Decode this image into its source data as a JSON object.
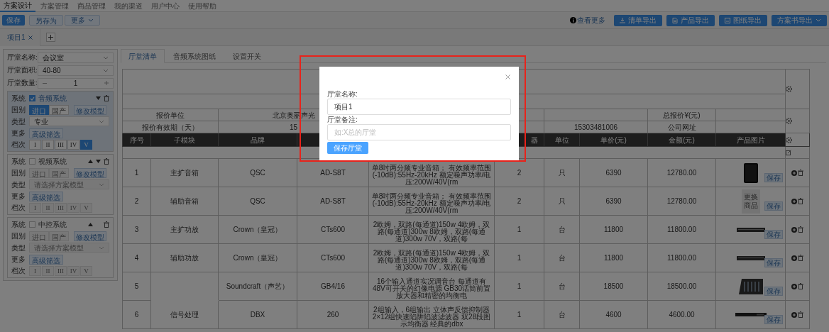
{
  "top_nav": [
    {
      "label": "方案设计",
      "selected": true
    },
    {
      "label": "方案管理",
      "selected": false
    },
    {
      "label": "商品管理",
      "selected": false
    },
    {
      "label": "我的渠道",
      "selected": false
    },
    {
      "label": "用户中心",
      "selected": false
    },
    {
      "label": "使用帮助",
      "selected": false
    }
  ],
  "toolbar": {
    "left_buttons": [
      {
        "label": "保存",
        "kind": "primary"
      },
      {
        "label": "另存为",
        "kind": "default"
      },
      {
        "label": "更多",
        "kind": "dropdown"
      }
    ],
    "help_link": "查看更多",
    "export_buttons": [
      {
        "label": "清单导出",
        "kind": "download"
      },
      {
        "label": "产品导出",
        "kind": "file"
      },
      {
        "label": "图纸导出",
        "kind": "image"
      },
      {
        "label": "方案书导出",
        "kind": "dropdown"
      }
    ]
  },
  "project_tabs": [
    {
      "label": "项目1",
      "selected": true
    }
  ],
  "left_panel": {
    "fields": [
      {
        "label": "厅堂名称:",
        "value": "会议室",
        "kind": "select"
      },
      {
        "label": "厅堂面积:",
        "value": "40-80",
        "kind": "select"
      },
      {
        "label": "厅堂数量:",
        "value": "1",
        "kind": "stepper"
      }
    ],
    "systems": [
      {
        "system_label": "系统",
        "name": "音频系统",
        "checked": true,
        "can_move_up": false,
        "can_move_down": true,
        "origin_label": "国别",
        "origins": [
          {
            "label": "进口",
            "selected": true
          },
          {
            "label": "国产",
            "selected": false
          }
        ],
        "modify_button": "修改模型",
        "type_label": "类型",
        "type_value": "专业",
        "more_label": "更多",
        "filter_button": "高级筛选",
        "grade_label": "档次",
        "grades": [
          {
            "label": "I",
            "selected": false
          },
          {
            "label": "II",
            "selected": false
          },
          {
            "label": "III",
            "selected": false
          },
          {
            "label": "IV",
            "selected": false
          },
          {
            "label": "V",
            "selected": true
          }
        ]
      },
      {
        "system_label": "系统",
        "name": "视频系统",
        "checked": false,
        "can_move_up": true,
        "can_move_down": true,
        "origin_label": "国别",
        "origins": [
          {
            "label": "进口",
            "selected": false
          },
          {
            "label": "国产",
            "selected": false
          }
        ],
        "modify_button": "修改模型",
        "type_label": "类型",
        "type_placeholder": "请选择方案模型",
        "more_label": "更多",
        "filter_button": "高级筛选",
        "grade_label": "档次",
        "grades": [
          {
            "label": "I",
            "selected": false
          },
          {
            "label": "II",
            "selected": false
          },
          {
            "label": "III",
            "selected": false
          },
          {
            "label": "IV",
            "selected": false
          },
          {
            "label": "V",
            "selected": false
          }
        ]
      },
      {
        "system_label": "系统",
        "name": "中控系统",
        "checked": false,
        "can_move_up": true,
        "can_move_down": false,
        "origin_label": "国别",
        "origins": [
          {
            "label": "进口",
            "selected": false
          },
          {
            "label": "国产",
            "selected": false
          }
        ],
        "modify_button": "修改模型",
        "type_label": "类型",
        "type_placeholder": "请选择方案模型",
        "more_label": "更多",
        "filter_button": "高级筛选",
        "grade_label": "档次",
        "grades": [
          {
            "label": "I",
            "selected": false
          },
          {
            "label": "II",
            "selected": false
          },
          {
            "label": "III",
            "selected": false
          },
          {
            "label": "IV",
            "selected": false
          },
          {
            "label": "V",
            "selected": false
          }
        ]
      }
    ]
  },
  "content_tabs": [
    {
      "label": "厅堂清单",
      "selected": true
    },
    {
      "label": "音频系统图纸",
      "selected": false
    },
    {
      "label": "设置开关",
      "selected": false
    }
  ],
  "sheet": {
    "info_rows": [
      {
        "label": "报价单位",
        "value": "北京奥丽声光",
        "field_label": "总报价¥(元)"
      },
      {
        "label": "报价有效期（天）",
        "value": "15",
        "contact": "15303481006",
        "field_label": "公司网址"
      }
    ],
    "header": {
      "seq": "序号",
      "module": "子模块",
      "brand": "品牌",
      "qty": "器",
      "unit": "单位",
      "price": "单价(元)",
      "amount": "金额(元)",
      "image": "产品图片"
    },
    "rows": [
      {
        "seq": "1",
        "module": "主扩音箱",
        "brand": "QSC",
        "model": "AD-S8T",
        "spec": "单8吋两分频专业音箱； 有效频率范围(-10dB):55Hz-20kHz 额定噪声功率/电压:200W/40V(rm",
        "qty": "2",
        "unit": "只",
        "price": "6390",
        "amount": "12780.00",
        "kind": "speaker",
        "save": "保存",
        "joined_with_next": false
      },
      {
        "seq": "2",
        "module": "辅助音箱",
        "brand": "QSC",
        "model": "AD-S8T",
        "spec": "单8吋两分频专业音箱； 有效频率范围(-10dB):55Hz-20kHz 额定噪声功率/电压:200W/40V(rm",
        "qty": "2",
        "unit": "只",
        "price": "6390",
        "amount": "12780.00",
        "kind": "placeholder",
        "image_text": "更换商品",
        "save": "保存",
        "joined_with_next": false
      },
      {
        "seq": "3",
        "module": "主扩功放",
        "brand": "Crown（皇冠）",
        "model": "CTs600",
        "spec": "2欧姆，双路(每通道)150w 4欧姆，双路(每通道)300w 8欧姆，双路(每通道)300w 70V，双路(每",
        "qty": "1",
        "unit": "台",
        "price": "11800",
        "amount": "11800.00",
        "kind": "amplifier",
        "save": "保存",
        "joined_with_next": false
      },
      {
        "seq": "4",
        "module": "辅助功放",
        "brand": "Crown（皇冠）",
        "model": "CTs600",
        "spec": "2欧姆，双路(每通道)150w 4欧姆，双路(每通道)300w 8欧姆，双路(每通道)300w 70V，双路(每",
        "qty": "1",
        "unit": "台",
        "price": "11800",
        "amount": "11800.00",
        "kind": "amplifier",
        "save": "保存",
        "joined_with_next": false
      },
      {
        "seq": "5",
        "brand": "Soundcraft（声艺）",
        "model": "GB4/16",
        "spec": "16个输入通道实况调音台 每通道有48V可开关的幻像电源 GB30话筒前置放大器和精密的均衡电",
        "qty": "1",
        "unit": "台",
        "price": "18500",
        "amount": "18500.00",
        "kind": "mixer",
        "save": "保存",
        "joined_with_next": true
      },
      {
        "seq": "6",
        "module": "信号处理",
        "brand": "DBX",
        "model": "260",
        "spec": "2组输入，6组输出 立体声反馈抑制器2×12组快速陷阱陷波滤波器 双28段图示均衡器 经典的dbx",
        "qty": "1",
        "unit": "台",
        "price": "4600",
        "amount": "4600.00",
        "kind": "rack",
        "save": "保存",
        "joined_with_next": false
      }
    ]
  },
  "modal": {
    "fields": [
      {
        "label": "厅堂名称:",
        "value": "项目1"
      },
      {
        "label": "厅堂备注:",
        "placeholder": "如:X总的厅堂"
      }
    ],
    "save_button": "保存厅堂"
  }
}
